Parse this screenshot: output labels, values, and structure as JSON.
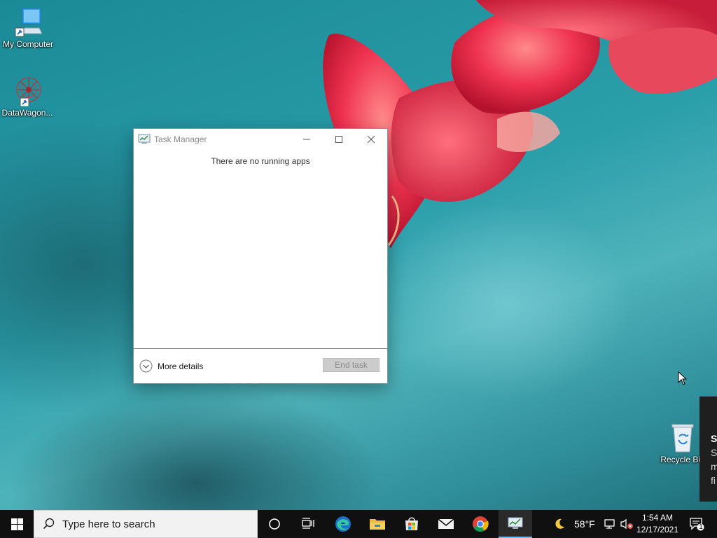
{
  "desktop": {
    "icons": [
      {
        "label": "My Computer"
      },
      {
        "label": "DataWagon..."
      },
      {
        "label": "Recycle Bin"
      }
    ]
  },
  "task_manager": {
    "title": "Task Manager",
    "empty_message": "There are no running apps",
    "more_details_label": "More details",
    "end_task_label": "End task"
  },
  "notification": {
    "title": "S",
    "lines": [
      "S",
      "m",
      "fi"
    ]
  },
  "taskbar": {
    "search_placeholder": "Type here to search",
    "pinned": [
      "cortana-icon",
      "task-view-icon",
      "edge-icon",
      "file-explorer-icon",
      "store-icon",
      "mail-icon",
      "chrome-icon",
      "task-manager-icon"
    ],
    "weather_temp": "58°F",
    "time": "1:54 AM",
    "date": "12/17/2021",
    "notification_count": "1"
  },
  "colors": {
    "taskbar_bg": "#101010",
    "active_indicator": "#76b9ed",
    "end_task_disabled_bg": "#cccccc"
  }
}
